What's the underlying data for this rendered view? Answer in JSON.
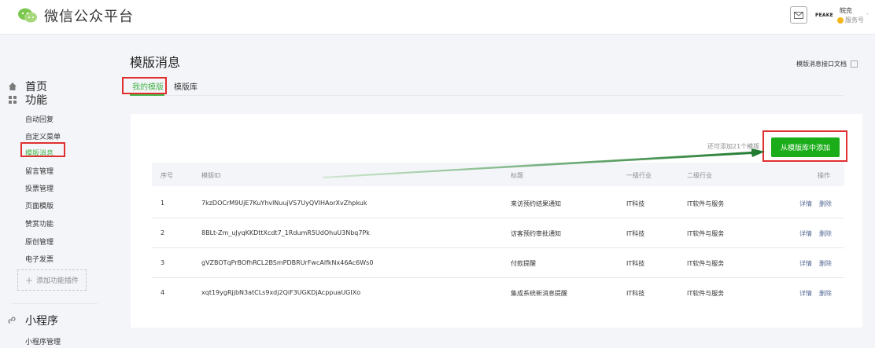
{
  "header": {
    "title": "微信公众平台",
    "account_logo": "PEAKE",
    "account_name": "皖克",
    "account_type": "服务号",
    "mail_icon": "mail-icon",
    "caret": "-"
  },
  "sidebar": {
    "home": "首页",
    "features_section": "功能",
    "items": [
      {
        "label": "自动回复"
      },
      {
        "label": "自定义菜单"
      },
      {
        "label": "模版消息"
      },
      {
        "label": "留言管理"
      },
      {
        "label": "投票管理"
      },
      {
        "label": "页面模版"
      },
      {
        "label": "赞赏功能"
      },
      {
        "label": "原创管理"
      },
      {
        "label": "电子发票"
      }
    ],
    "add_plugin": "添加功能插件",
    "miniprogram_section": "小程序",
    "miniprogram_items": [
      {
        "label": "小程序管理"
      }
    ]
  },
  "main": {
    "title": "模版消息",
    "doc_link": "模版消息接口文档",
    "tabs": [
      {
        "label": "我的模版"
      },
      {
        "label": "模版库"
      }
    ],
    "quota_text": "还可添加21个模版",
    "add_button": "从模版库中添加",
    "table": {
      "headers": [
        "序号",
        "模版ID",
        "标题",
        "一级行业",
        "二级行业",
        "操作"
      ],
      "rows": [
        {
          "no": "1",
          "id": "7kzDOCrM9UjE7KuYhvlNuujVS7UyQVIHAorXvZhpkuk",
          "title": "来访预约结果通知",
          "ind1": "IT科技",
          "ind2": "IT软件与服务",
          "detail": "详情",
          "delete": "删除"
        },
        {
          "no": "2",
          "id": "8BLt-Zm_uJyqKKDttXcdt7_1RdumR5UdOhuU3Nbq7Pk",
          "title": "访客预约审批通知",
          "ind1": "IT科技",
          "ind2": "IT软件与服务",
          "detail": "详情",
          "delete": "删除"
        },
        {
          "no": "3",
          "id": "gVZBOTqPrBOfhRCL2BSmPDBRUrFwcAlfkNx46Ac6Ws0",
          "title": "付款提醒",
          "ind1": "IT科技",
          "ind2": "IT软件与服务",
          "detail": "详情",
          "delete": "删除"
        },
        {
          "no": "4",
          "id": "xqt19ygRjjbN3atCLs9xdj2QiF3UGKDjAcppuaUGIXo",
          "title": "集成系统新消息提醒",
          "ind1": "IT科技",
          "ind2": "IT软件与服务",
          "detail": "详情",
          "delete": "删除"
        }
      ]
    }
  },
  "colors": {
    "brand_green": "#44b549",
    "button_green": "#1aad19",
    "highlight_red": "#e02f2f",
    "link_blue": "#576b95",
    "arrow_green": "#2e8b3e"
  }
}
